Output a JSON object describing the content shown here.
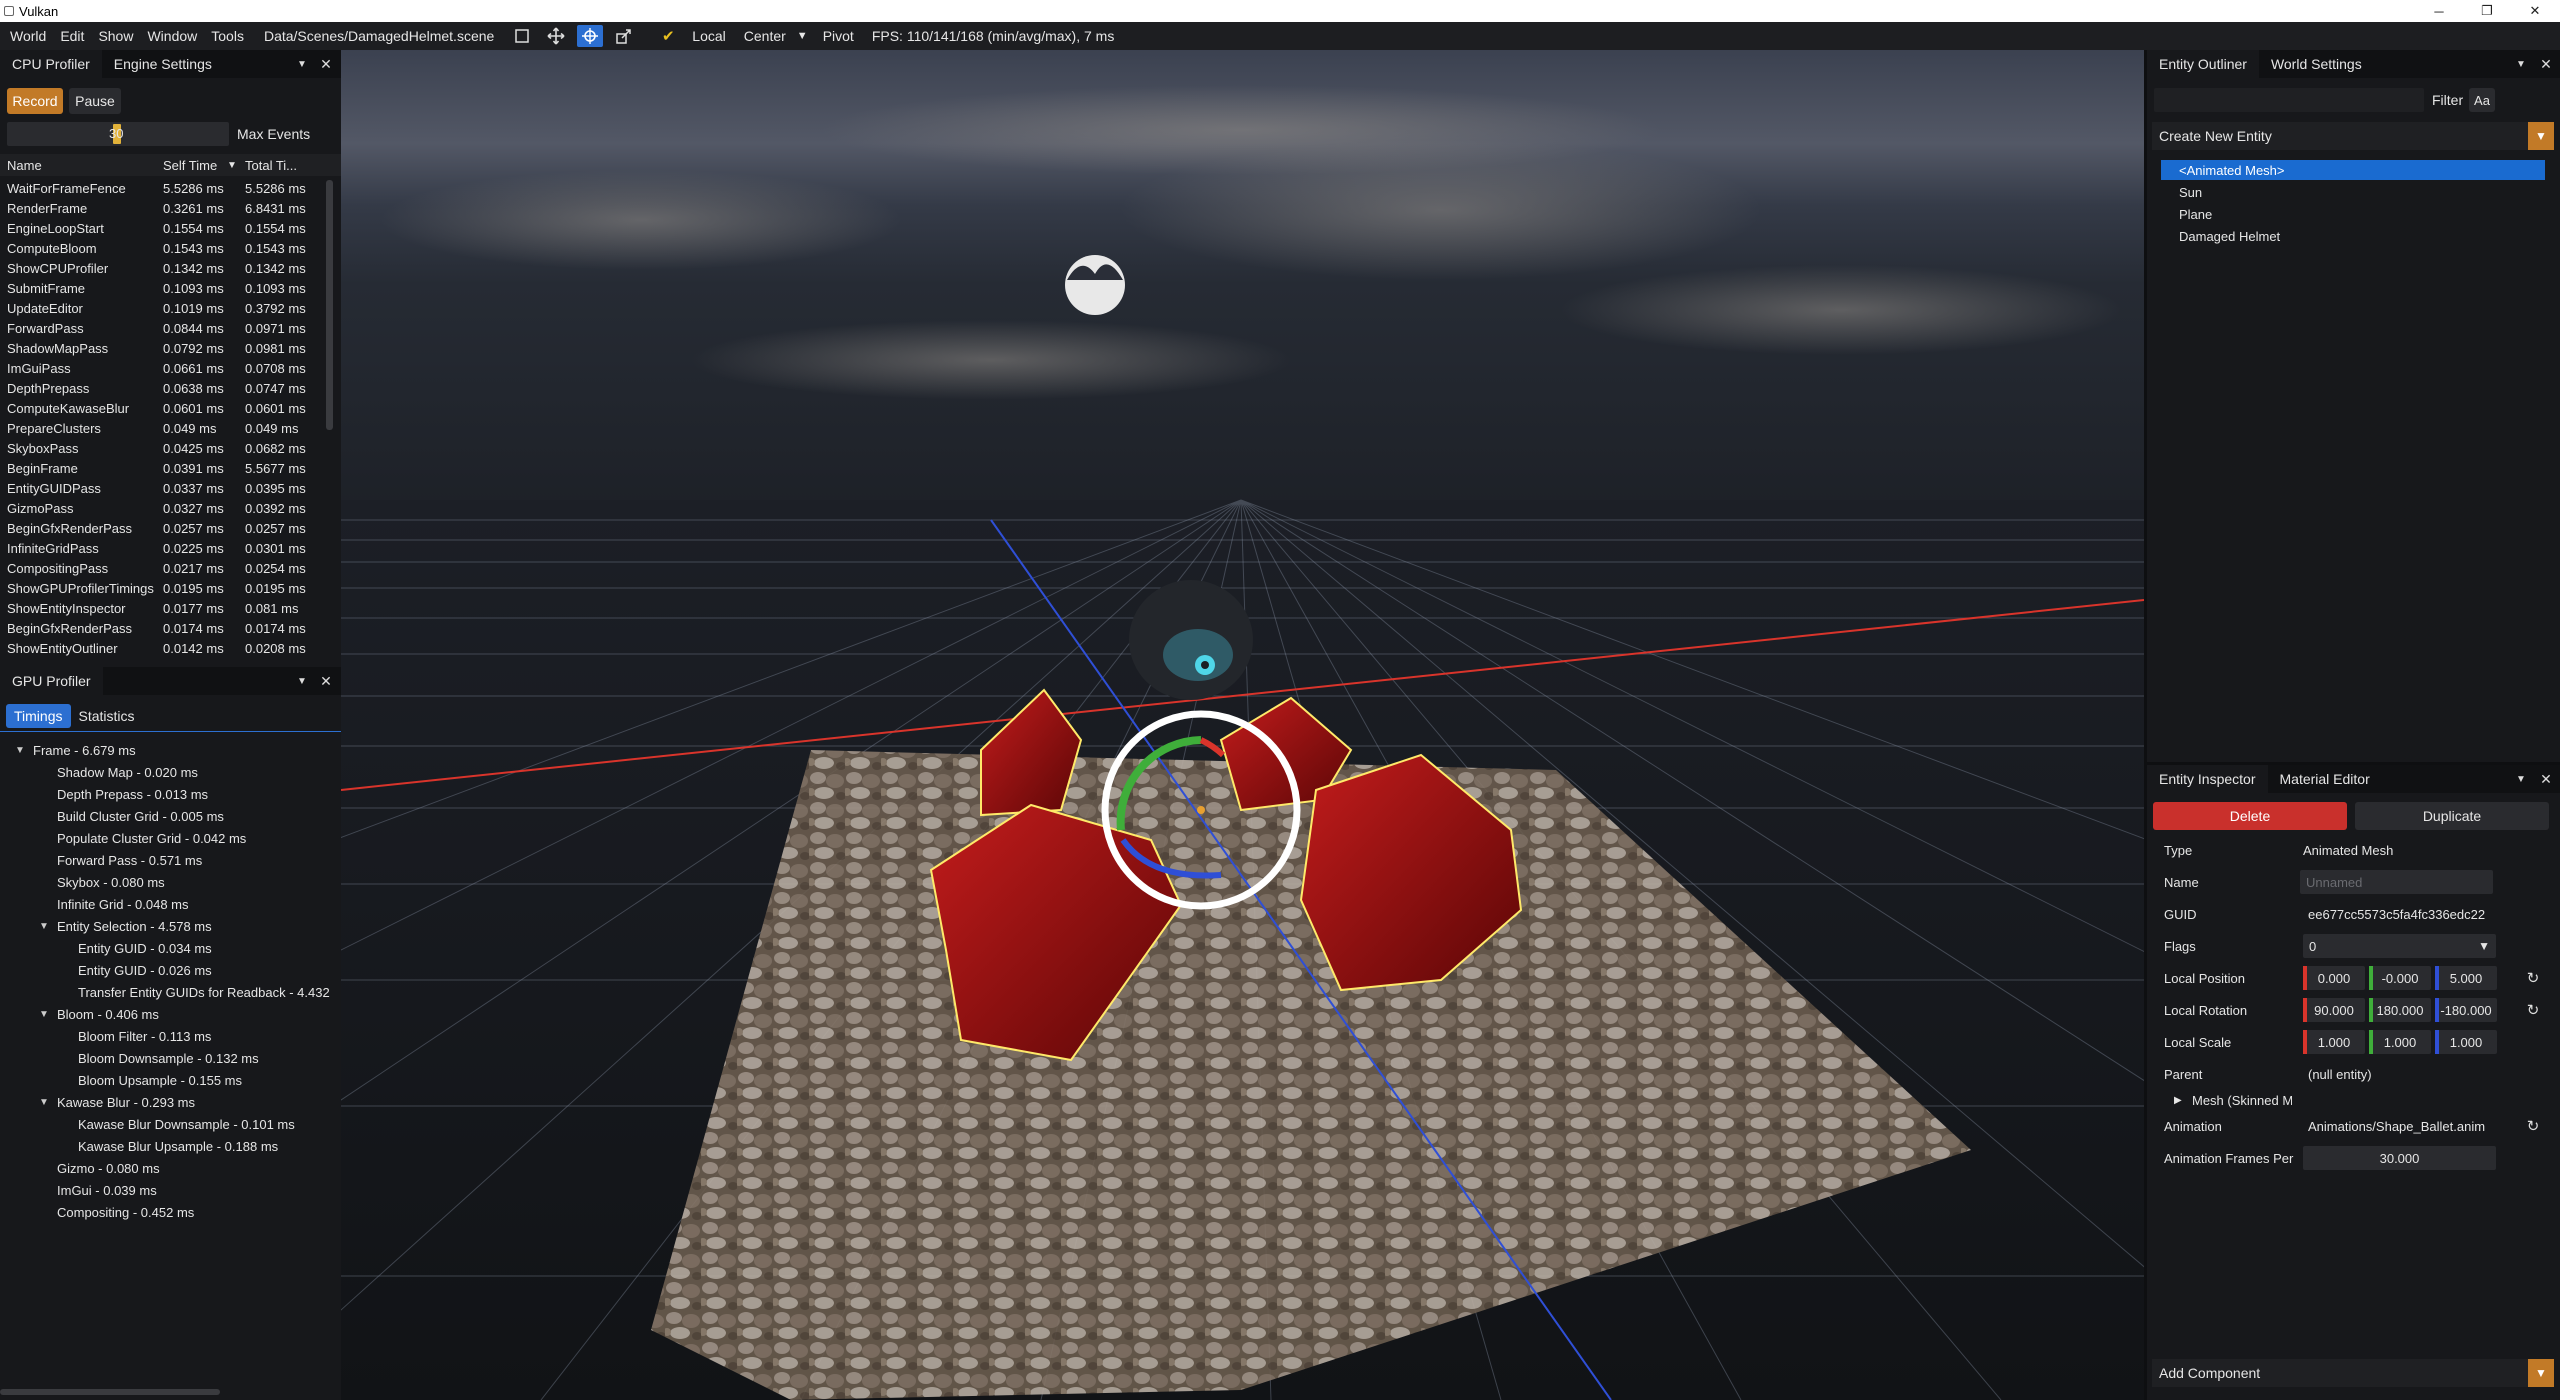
{
  "window": {
    "title": "Vulkan",
    "minimize": "─",
    "restore": "❐",
    "close": "✕"
  },
  "menu": {
    "items": [
      "World",
      "Edit",
      "Show",
      "Window",
      "Tools"
    ],
    "scene_path": "Data/Scenes/DamagedHelmet.scene",
    "local_label": "Local",
    "center_label": "Center",
    "pivot_label": "Pivot",
    "fps_text": "FPS: 110/141/168 (min/avg/max), 7 ms"
  },
  "cpu_profiler": {
    "tabs": [
      "CPU Profiler",
      "Engine Settings"
    ],
    "record_label": "Record",
    "pause_label": "Pause",
    "slider_value": "30",
    "max_events_label": "Max Events",
    "columns": [
      "Name",
      "Self Time",
      "Total Ti..."
    ],
    "rows": [
      {
        "name": "WaitForFrameFence",
        "self": "5.5286 ms",
        "total": "5.5286 ms"
      },
      {
        "name": "RenderFrame",
        "self": "0.3261 ms",
        "total": "6.8431 ms"
      },
      {
        "name": "EngineLoopStart",
        "self": "0.1554 ms",
        "total": "0.1554 ms"
      },
      {
        "name": "ComputeBloom",
        "self": "0.1543 ms",
        "total": "0.1543 ms"
      },
      {
        "name": "ShowCPUProfiler",
        "self": "0.1342 ms",
        "total": "0.1342 ms"
      },
      {
        "name": "SubmitFrame",
        "self": "0.1093 ms",
        "total": "0.1093 ms"
      },
      {
        "name": "UpdateEditor",
        "self": "0.1019 ms",
        "total": "0.3792 ms"
      },
      {
        "name": "ForwardPass",
        "self": "0.0844 ms",
        "total": "0.0971 ms"
      },
      {
        "name": "ShadowMapPass",
        "self": "0.0792 ms",
        "total": "0.0981 ms"
      },
      {
        "name": "ImGuiPass",
        "self": "0.0661 ms",
        "total": "0.0708 ms"
      },
      {
        "name": "DepthPrepass",
        "self": "0.0638 ms",
        "total": "0.0747 ms"
      },
      {
        "name": "ComputeKawaseBlur",
        "self": "0.0601 ms",
        "total": "0.0601 ms"
      },
      {
        "name": "PrepareClusters",
        "self": "0.049 ms",
        "total": "0.049 ms"
      },
      {
        "name": "SkyboxPass",
        "self": "0.0425 ms",
        "total": "0.0682 ms"
      },
      {
        "name": "BeginFrame",
        "self": "0.0391 ms",
        "total": "5.5677 ms"
      },
      {
        "name": "EntityGUIDPass",
        "self": "0.0337 ms",
        "total": "0.0395 ms"
      },
      {
        "name": "GizmoPass",
        "self": "0.0327 ms",
        "total": "0.0392 ms"
      },
      {
        "name": "BeginGfxRenderPass",
        "self": "0.0257 ms",
        "total": "0.0257 ms"
      },
      {
        "name": "InfiniteGridPass",
        "self": "0.0225 ms",
        "total": "0.0301 ms"
      },
      {
        "name": "CompositingPass",
        "self": "0.0217 ms",
        "total": "0.0254 ms"
      },
      {
        "name": "ShowGPUProfilerTimings",
        "self": "0.0195 ms",
        "total": "0.0195 ms"
      },
      {
        "name": "ShowEntityInspector",
        "self": "0.0177 ms",
        "total": "0.081 ms"
      },
      {
        "name": "BeginGfxRenderPass",
        "self": "0.0174 ms",
        "total": "0.0174 ms"
      },
      {
        "name": "ShowEntityOutliner",
        "self": "0.0142 ms",
        "total": "0.0208 ms"
      }
    ]
  },
  "gpu_profiler": {
    "title": "GPU Profiler",
    "tabs": [
      "Timings",
      "Statistics"
    ],
    "tree": [
      {
        "text": "Frame -  6.679 ms",
        "level": 0,
        "toggle": true
      },
      {
        "text": "Shadow Map -  0.020 ms",
        "level": 1,
        "toggle": false
      },
      {
        "text": "Depth Prepass -  0.013 ms",
        "level": 1,
        "toggle": false
      },
      {
        "text": "Build Cluster Grid -  0.005 ms",
        "level": 1,
        "toggle": false
      },
      {
        "text": "Populate Cluster Grid -  0.042 ms",
        "level": 1,
        "toggle": false
      },
      {
        "text": "Forward Pass -  0.571 ms",
        "level": 1,
        "toggle": false
      },
      {
        "text": "Skybox -  0.080 ms",
        "level": 1,
        "toggle": false
      },
      {
        "text": "Infinite Grid -  0.048 ms",
        "level": 1,
        "toggle": false
      },
      {
        "text": "Entity Selection -  4.578 ms",
        "level": 1,
        "toggle": true
      },
      {
        "text": "Entity GUID -  0.034 ms",
        "level": 2,
        "toggle": false
      },
      {
        "text": "Entity GUID -  0.026 ms",
        "level": 2,
        "toggle": false
      },
      {
        "text": "Transfer Entity GUIDs for Readback -  4.432",
        "level": 2,
        "toggle": false
      },
      {
        "text": "Bloom -  0.406 ms",
        "level": 1,
        "toggle": true
      },
      {
        "text": "Bloom Filter -  0.113 ms",
        "level": 2,
        "toggle": false
      },
      {
        "text": "Bloom Downsample -  0.132 ms",
        "level": 2,
        "toggle": false
      },
      {
        "text": "Bloom Upsample -  0.155 ms",
        "level": 2,
        "toggle": false
      },
      {
        "text": "Kawase Blur -  0.293 ms",
        "level": 1,
        "toggle": true
      },
      {
        "text": "Kawase Blur Downsample -  0.101 ms",
        "level": 2,
        "toggle": false
      },
      {
        "text": "Kawase Blur Upsample -  0.188 ms",
        "level": 2,
        "toggle": false
      },
      {
        "text": "Gizmo -  0.080 ms",
        "level": 1,
        "toggle": false
      },
      {
        "text": "ImGui -  0.039 ms",
        "level": 1,
        "toggle": false
      },
      {
        "text": "Compositing -  0.452 ms",
        "level": 1,
        "toggle": false
      }
    ]
  },
  "outliner": {
    "tabs": [
      "Entity Outliner",
      "World Settings"
    ],
    "filter_label": "Filter",
    "case_label": "Aa",
    "create_label": "Create New Entity",
    "entities": [
      "<Animated Mesh>",
      "Sun",
      "Plane",
      "Damaged Helmet"
    ]
  },
  "inspector": {
    "tabs": [
      "Entity Inspector",
      "Material Editor"
    ],
    "delete_label": "Delete",
    "duplicate_label": "Duplicate",
    "type_label": "Type",
    "type_value": "Animated Mesh",
    "name_label": "Name",
    "name_placeholder": "Unnamed",
    "guid_label": "GUID",
    "guid_value": "ee677cc5573c5fa4fc336edc22",
    "flags_label": "Flags",
    "flags_value": "0",
    "position_label": "Local Position",
    "position": [
      "0.000",
      "-0.000",
      "5.000"
    ],
    "rotation_label": "Local Rotation",
    "rotation": [
      "90.000",
      "180.000",
      "-180.000"
    ],
    "scale_label": "Local Scale",
    "scale": [
      "1.000",
      "1.000",
      "1.000"
    ],
    "parent_label": "Parent",
    "parent_value": "(null entity)",
    "mesh_label": "Mesh (Skinned M",
    "animation_label": "Animation",
    "animation_value": "Animations/Shape_Ballet.anim",
    "fps_label": "Animation Frames Per",
    "fps_value": "30.000",
    "add_component_label": "Add Component"
  },
  "colors": {
    "accent_blue": "#2c6fd1",
    "record_orange": "#c27a27",
    "delete_red": "#c9302c",
    "axis_x": "#d9342b",
    "axis_y": "#3fae3a",
    "axis_z": "#2f4fd6",
    "selection_yellow": "#ffe96a"
  }
}
